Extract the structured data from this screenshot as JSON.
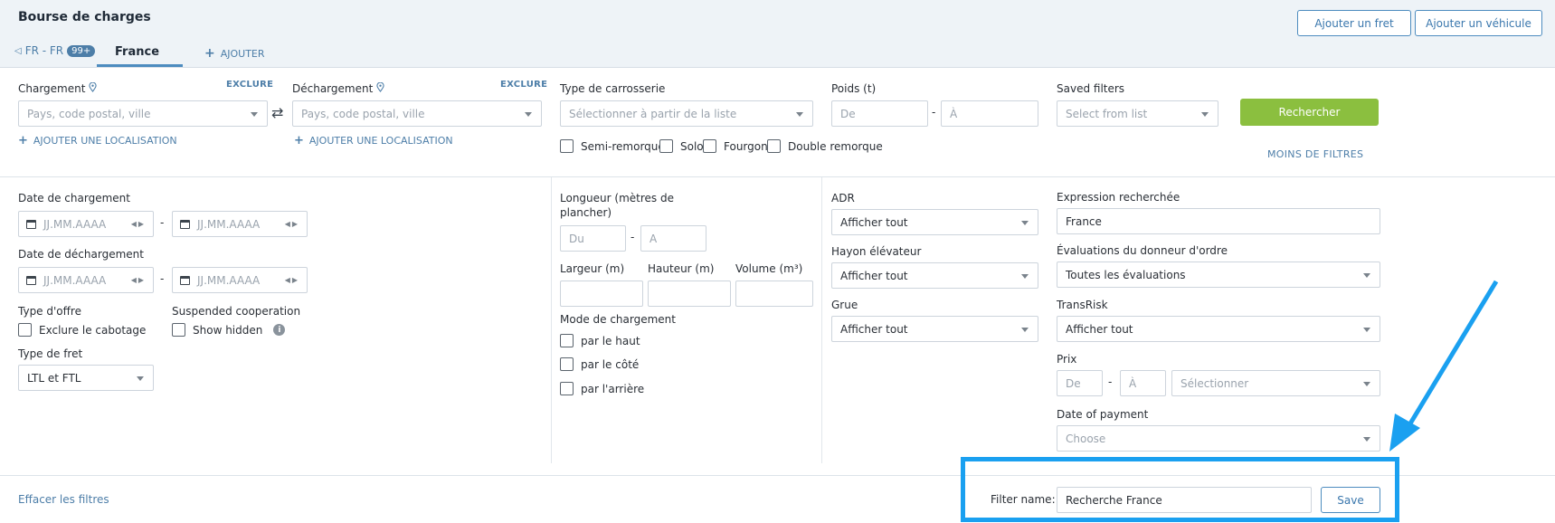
{
  "header": {
    "title": "Bourse de charges",
    "add_freight": "Ajouter un fret",
    "add_vehicle": "Ajouter un véhicule",
    "tab_lang": "FR - FR",
    "tab_badge": "99+",
    "tab_active": "France",
    "tab_add": "AJOUTER"
  },
  "filters": {
    "loading_label": "Chargement",
    "unloading_label": "Déchargement",
    "exclude": "EXCLURE",
    "location_placeholder": "Pays, code postal, ville",
    "add_location": "AJOUTER UNE LOCALISATION",
    "body_type_label": "Type de carrosserie",
    "body_type_placeholder": "Sélectionner à partir de la liste",
    "body_types": [
      "Semi-remorque",
      "Solo",
      "Fourgon",
      "Double remorque"
    ],
    "weight_label": "Poids (t)",
    "weight_from": "De",
    "weight_to": "À",
    "saved_filters_label": "Saved filters",
    "saved_filters_placeholder": "Select from list",
    "search_button": "Rechercher",
    "less_filters": "MOINS DE FILTRES"
  },
  "advanced": {
    "loading_date_label": "Date de chargement",
    "unloading_date_label": "Date de déchargement",
    "date_placeholder": "JJ.MM.AAAA",
    "offer_type_label": "Type d'offre",
    "exclude_cabotage": "Exclure le cabotage",
    "suspended_label": "Suspended cooperation",
    "show_hidden": "Show hidden",
    "freight_type_label": "Type de fret",
    "freight_type_value": "LTL et FTL",
    "length_label_1": "Longueur (mètres de",
    "length_label_2": "plancher)",
    "length_from": "Du",
    "length_to": "A",
    "width_label": "Largeur (m)",
    "height_label": "Hauteur (m)",
    "volume_label": "Volume (m³)",
    "loading_mode_label": "Mode de chargement",
    "loading_modes": [
      "par le haut",
      "par le côté",
      "par l'arrière"
    ],
    "adr_label": "ADR",
    "adr_value": "Afficher tout",
    "lift_label": "Hayon élévateur",
    "lift_value": "Afficher tout",
    "crane_label": "Grue",
    "crane_value": "Afficher tout",
    "expression_label": "Expression recherchée",
    "expression_value": "France",
    "ratings_label": "Évaluations du donneur d'ordre",
    "ratings_value": "Toutes les évaluations",
    "transrisk_label": "TransRisk",
    "transrisk_value": "Afficher tout",
    "price_label": "Prix",
    "price_from": "De",
    "price_to": "À",
    "price_currency_placeholder": "Sélectionner",
    "payment_date_label": "Date of payment",
    "payment_date_placeholder": "Choose"
  },
  "footer": {
    "clear_filters": "Effacer les filtres",
    "filter_name_label": "Filter name:",
    "filter_name_value": "Recherche France",
    "save_button": "Save"
  },
  "colors": {
    "accent": "#4d8cbf",
    "green": "#8bbf3f",
    "highlight": "#1aa0f0"
  }
}
